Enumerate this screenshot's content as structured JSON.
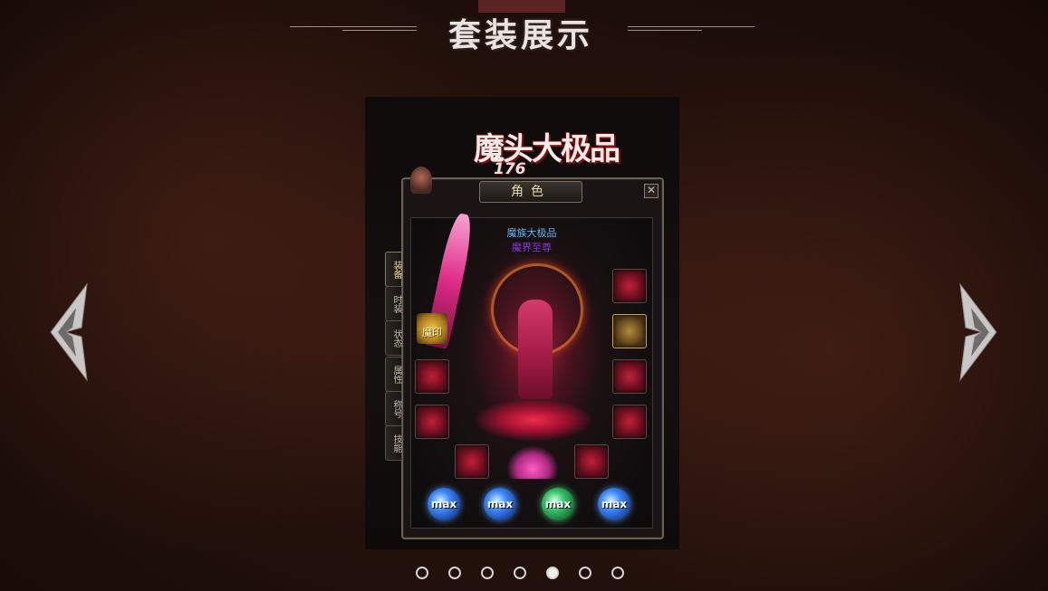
{
  "header": {
    "title": "套装展示"
  },
  "showcase": {
    "logo_title": "魔头大极品",
    "logo_subtitle": "176",
    "panel": {
      "title": "角色",
      "close_label": "✕",
      "character_name": "魔族大极品",
      "character_title": "魔界至尊",
      "mark_label": "魔印",
      "side_tabs": [
        "装备",
        "时装",
        "状态",
        "属性",
        "称号",
        "技能"
      ],
      "active_tab": 0,
      "orbs": [
        "max",
        "max",
        "max",
        "max"
      ]
    }
  },
  "carousel": {
    "prev_icon": "chevron-left-icon",
    "next_icon": "chevron-right-icon",
    "total_slides": 7,
    "active_slide": 5
  },
  "colors": {
    "accent": "#e9d9a8",
    "name_color": "#5fb6f5",
    "title_color": "#8a3ad6"
  }
}
